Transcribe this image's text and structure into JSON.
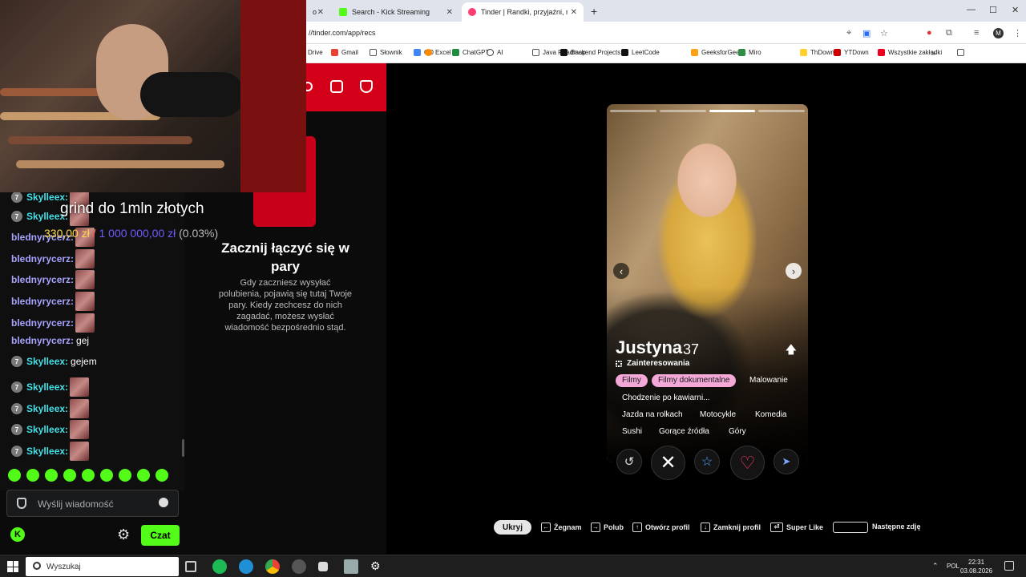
{
  "browser": {
    "tabs": [
      {
        "label": "Search - Kick Streaming",
        "favicon_color": "#53fc18"
      },
      {
        "label": "Tinder | Randki, przyjaźni, nowe",
        "favicon_color": "#fe3c72"
      }
    ],
    "url": "//tinder.com/app/recs",
    "bookmarks": [
      "Drive",
      "Gmail",
      "Słownik",
      "GD",
      "Excel",
      "ChatGPT",
      "AI",
      "Java Roadmap",
      "Backend Projects",
      "LeetCode",
      "GeeksforGeeks",
      "Miro",
      "ThDown",
      "YTDown",
      "Wszystkie zakładki"
    ]
  },
  "stream": {
    "goal_title": "grind do 1mln złotych",
    "goal_current": "330,00 zł",
    "goal_separator": "/",
    "goal_target": "1 000 000,00 zł",
    "goal_percent": "(0.03%)"
  },
  "chat": {
    "messages": [
      {
        "badge": "7",
        "user": "Skylleex:",
        "text": "",
        "emote": true
      },
      {
        "badge": "7",
        "user": "Skylleex:",
        "text": "",
        "emote": true
      },
      {
        "badge": "",
        "user": "blednyrycerz:",
        "text": "",
        "emote": true
      },
      {
        "badge": "",
        "user": "blednyrycerz:",
        "text": "",
        "emote": true
      },
      {
        "badge": "",
        "user": "blednyrycerz:",
        "text": "",
        "emote": true
      },
      {
        "badge": "",
        "user": "blednyrycerz:",
        "text": "",
        "emote": true
      },
      {
        "badge": "",
        "user": "blednyrycerz:",
        "text": "",
        "emote": true
      },
      {
        "badge": "",
        "user": "blednyrycerz:",
        "text": "gej",
        "emote": false
      },
      {
        "badge": "7",
        "user": "Skylleex:",
        "text": "gejem",
        "emote": false
      },
      {
        "badge": "7",
        "user": "Skylleex:",
        "text": "",
        "emote": true
      },
      {
        "badge": "7",
        "user": "Skylleex:",
        "text": "",
        "emote": true
      },
      {
        "badge": "7",
        "user": "Skylleex:",
        "text": "",
        "emote": true
      },
      {
        "badge": "7",
        "user": "Skylleex:",
        "text": "",
        "emote": true
      }
    ],
    "input_placeholder": "Wyślij wiadomość",
    "send_label": "Czat",
    "kick_logo": "K"
  },
  "matches": {
    "title": "Zacznij łączyć się w pary",
    "body": "Gdy zaczniesz wysyłać polubienia, pojawią się tutaj Twoje pary. Kiedy zechcesz do nich zagadać, możesz wysłać wiadomość bezpośrednio stąd."
  },
  "profile": {
    "name": "Justyna",
    "age": "37",
    "interests_label": "Zainteresowania",
    "interests": [
      {
        "label": "Filmy",
        "highlight": true
      },
      {
        "label": "Filmy dokumentalne",
        "highlight": true
      },
      {
        "label": "Malowanie",
        "highlight": false
      },
      {
        "label": "Chodzenie po kawiarni...",
        "highlight": false
      },
      {
        "label": "Jazda na rolkach",
        "highlight": false
      },
      {
        "label": "Motocykle",
        "highlight": false
      },
      {
        "label": "Komedia",
        "highlight": false
      },
      {
        "label": "Sushi",
        "highlight": false
      },
      {
        "label": "Gorące źródła",
        "highlight": false
      },
      {
        "label": "Góry",
        "highlight": false
      }
    ],
    "photo_count": 4,
    "photo_active_index": 2
  },
  "shortcuts": {
    "hide": "Ukryj",
    "nope": "Żegnam",
    "like": "Polub",
    "open_profile": "Otwórz profil",
    "close_profile": "Zamknij profil",
    "super_like": "Super Like",
    "next_photo": "Następne zdję"
  },
  "taskbar": {
    "search_placeholder": "Wyszukaj",
    "lang": "POL",
    "time": "22:31",
    "date": "03.08.2026"
  }
}
